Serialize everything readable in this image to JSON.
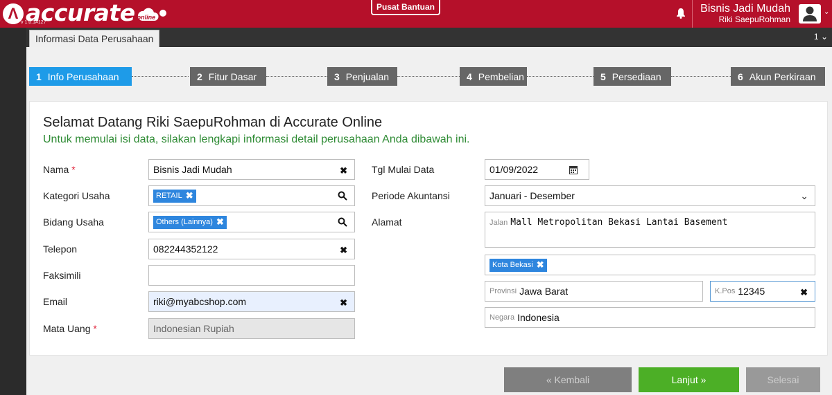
{
  "header": {
    "logo_text": "accurate",
    "logo_sub": "online",
    "version": "v 1.0.1#127",
    "help_label": "Pusat Bantuan",
    "company": "Bisnis Jadi Mudah",
    "user": "Riki SaepuRohman"
  },
  "tabs": {
    "active_label": "Informasi Data Perusahaan",
    "count": "1"
  },
  "steps": [
    {
      "num": "1",
      "label": "Info Perusahaan",
      "active": true
    },
    {
      "num": "2",
      "label": "Fitur Dasar",
      "active": false
    },
    {
      "num": "3",
      "label": "Penjualan",
      "active": false
    },
    {
      "num": "4",
      "label": "Pembelian",
      "active": false
    },
    {
      "num": "5",
      "label": "Persediaan",
      "active": false
    },
    {
      "num": "6",
      "label": "Akun Perkiraan",
      "active": false
    }
  ],
  "welcome": {
    "title": "Selamat Datang Riki SaepuRohman di Accurate Online",
    "subtitle": "Untuk memulai isi data, silakan lengkapi informasi detail perusahaan Anda dibawah ini."
  },
  "form": {
    "nama": {
      "label": "Nama",
      "value": "Bisnis Jadi Mudah"
    },
    "kategori": {
      "label": "Kategori Usaha",
      "tag": "RETAIL"
    },
    "bidang": {
      "label": "Bidang Usaha",
      "tag": "Others (Lainnya)"
    },
    "telepon": {
      "label": "Telepon",
      "value": "082244352122"
    },
    "faksimili": {
      "label": "Faksimili",
      "value": ""
    },
    "email": {
      "label": "Email",
      "value": "riki@myabcshop.com"
    },
    "mata_uang": {
      "label": "Mata Uang",
      "value": "Indonesian Rupiah"
    },
    "tgl_mulai": {
      "label": "Tgl Mulai Data",
      "value": "01/09/2022"
    },
    "periode": {
      "label": "Periode Akuntansi",
      "value": "Januari - Desember"
    },
    "alamat": {
      "label": "Alamat",
      "jalan_prefix": "Jalan",
      "jalan": "Mall Metropolitan Bekasi Lantai Basement",
      "kota_tag": "Kota Bekasi",
      "provinsi_prefix": "Provinsi",
      "provinsi": "Jawa Barat",
      "kpos_prefix": "K.Pos",
      "kpos": "12345",
      "negara_prefix": "Negara",
      "negara": "Indonesia"
    },
    "required_mark": "*"
  },
  "buttons": {
    "back": "« Kembali",
    "next": "Lanjut »",
    "done": "Selesai"
  },
  "colors": {
    "brand": "#b5102a",
    "step_active": "#1e9be8",
    "step_inactive": "#666666",
    "subtitle_green": "#2e8b34",
    "next_button": "#4caf26",
    "tag_blue": "#2e86de"
  }
}
